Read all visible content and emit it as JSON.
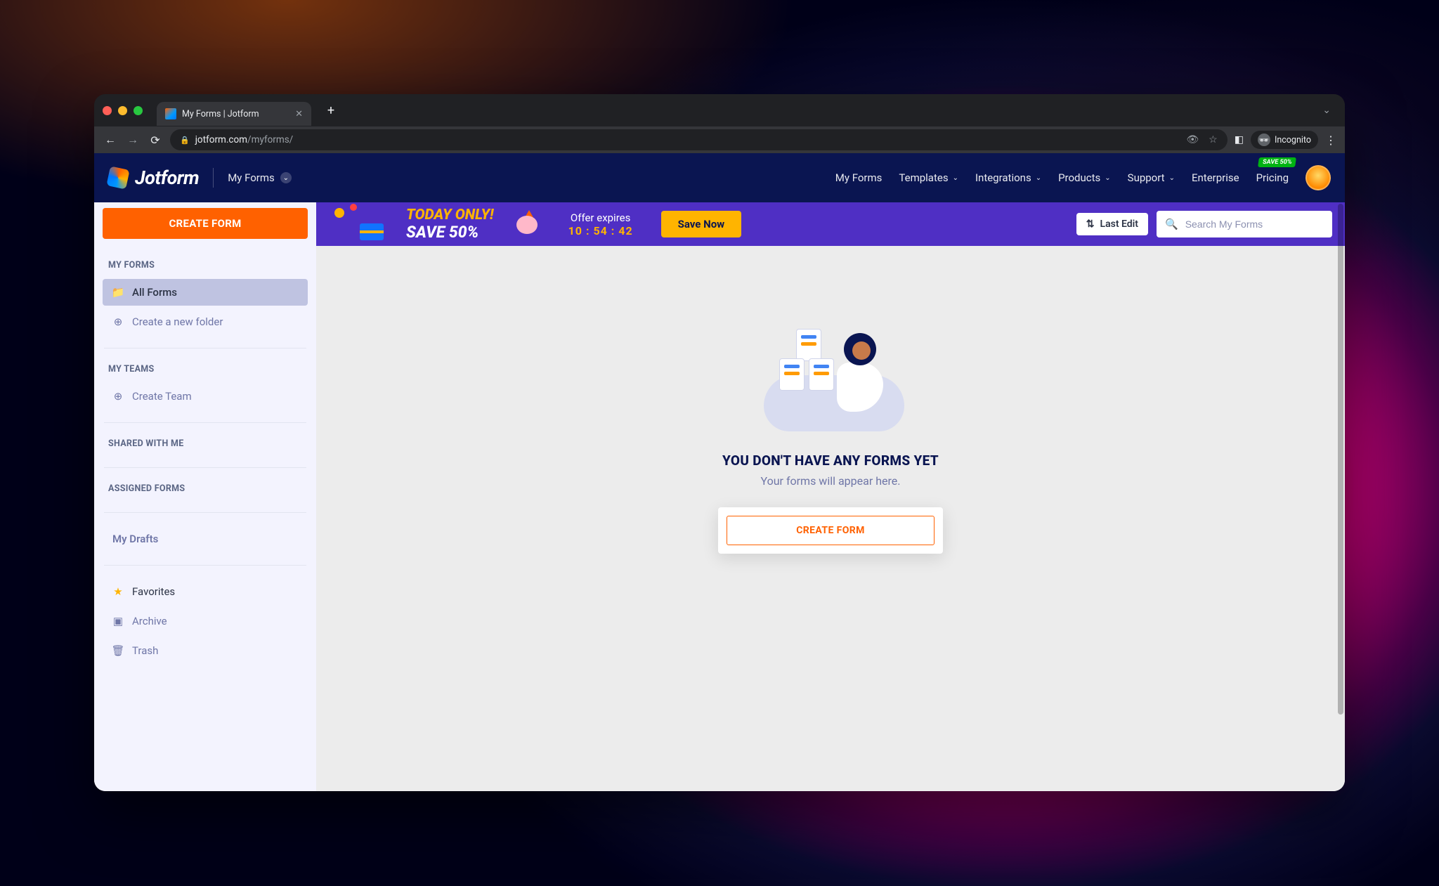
{
  "browser": {
    "tab_title": "My Forms | Jotform",
    "url_domain": "jotform.com",
    "url_path": "/myforms/",
    "incognito_label": "Incognito"
  },
  "header": {
    "brand": "Jotform",
    "my_forms_label": "My Forms",
    "nav": {
      "my_forms": "My Forms",
      "templates": "Templates",
      "integrations": "Integrations",
      "products": "Products",
      "support": "Support",
      "enterprise": "Enterprise",
      "pricing": "Pricing"
    },
    "save_badge": "SAVE 50%"
  },
  "sidebar": {
    "create_form": "CREATE FORM",
    "sections": {
      "my_forms": "MY FORMS",
      "my_teams": "MY TEAMS",
      "shared": "SHARED WITH ME",
      "assigned": "ASSIGNED FORMS",
      "drafts": "My Drafts"
    },
    "items": {
      "all_forms": "All Forms",
      "create_folder": "Create a new folder",
      "create_team": "Create Team",
      "favorites": "Favorites",
      "archive": "Archive",
      "trash": "Trash"
    }
  },
  "promo": {
    "line1": "TODAY ONLY!",
    "line2": "SAVE 50%",
    "offer_label": "Offer expires",
    "offer_time": "10 : 54 : 42",
    "save_now": "Save Now",
    "last_edit": "Last Edit",
    "search_placeholder": "Search My Forms"
  },
  "empty_state": {
    "title": "YOU DON'T HAVE ANY FORMS YET",
    "subtitle": "Your forms will appear here.",
    "cta": "CREATE FORM"
  }
}
